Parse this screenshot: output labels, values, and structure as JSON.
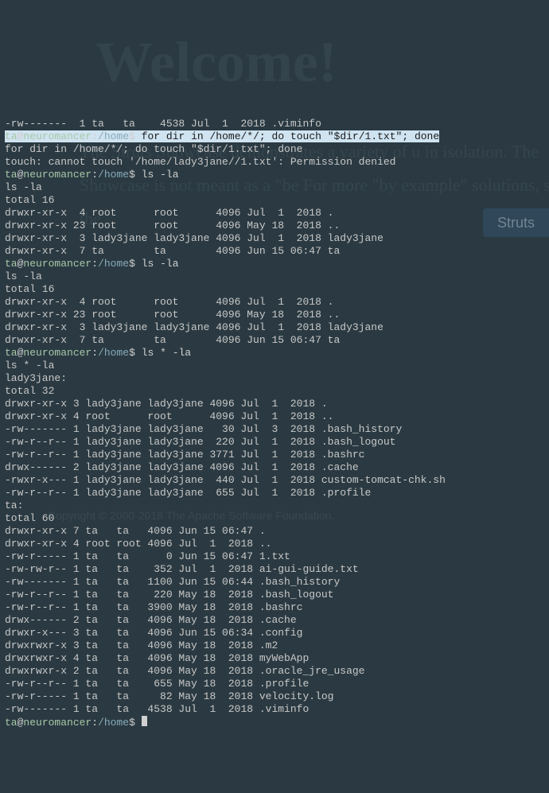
{
  "prompt": {
    "user": "ta",
    "host": "neuromancer",
    "path": "/home",
    "sigil": "$"
  },
  "background": {
    "heading": "Welcome!",
    "paragraph": "The Struts Showcase demonstrates a variety of u       in isolation. The Showcase is not meant as a \"be       For more \"by example\" solutions, see the",
    "button": "Struts",
    "footer": "Copyright © 2000-2018 The Apache Software Foundation."
  },
  "lines": [
    {
      "t": "out",
      "text": "-rw-------  1 ta   ta    4538 Jul  1  2018 .viminfo"
    },
    {
      "t": "prompt_hl",
      "cmd_pre": "for dir in /home/*/; do touch \"$dir/1.txt\"; done"
    },
    {
      "t": "out",
      "text": "for dir in /home/*/; do touch \"$dir/1.txt\"; done"
    },
    {
      "t": "out",
      "text": "touch: cannot touch '/home/lady3jane//1.txt': Permission denied"
    },
    {
      "t": "prompt",
      "cmd": "ls -la"
    },
    {
      "t": "out",
      "text": "ls -la"
    },
    {
      "t": "out",
      "text": "total 16"
    },
    {
      "t": "out",
      "text": "drwxr-xr-x  4 root      root      4096 Jul  1  2018 ."
    },
    {
      "t": "out",
      "text": "drwxr-xr-x 23 root      root      4096 May 18  2018 .."
    },
    {
      "t": "out",
      "text": "drwxr-xr-x  3 lady3jane lady3jane 4096 Jul  1  2018 lady3jane"
    },
    {
      "t": "out",
      "text": "drwxr-xr-x  7 ta        ta        4096 Jun 15 06:47 ta"
    },
    {
      "t": "prompt",
      "cmd": "ls -la"
    },
    {
      "t": "out",
      "text": "ls -la"
    },
    {
      "t": "out",
      "text": "total 16"
    },
    {
      "t": "out",
      "text": "drwxr-xr-x  4 root      root      4096 Jul  1  2018 ."
    },
    {
      "t": "out",
      "text": "drwxr-xr-x 23 root      root      4096 May 18  2018 .."
    },
    {
      "t": "out",
      "text": "drwxr-xr-x  3 lady3jane lady3jane 4096 Jul  1  2018 lady3jane"
    },
    {
      "t": "out",
      "text": "drwxr-xr-x  7 ta        ta        4096 Jun 15 06:47 ta"
    },
    {
      "t": "prompt",
      "cmd": "ls * -la"
    },
    {
      "t": "out",
      "text": "ls * -la"
    },
    {
      "t": "out",
      "text": "lady3jane:"
    },
    {
      "t": "out",
      "text": "total 32"
    },
    {
      "t": "out",
      "text": "drwxr-xr-x 3 lady3jane lady3jane 4096 Jul  1  2018 ."
    },
    {
      "t": "out",
      "text": "drwxr-xr-x 4 root      root      4096 Jul  1  2018 .."
    },
    {
      "t": "out",
      "text": "-rw------- 1 lady3jane lady3jane   30 Jul  3  2018 .bash_history"
    },
    {
      "t": "out",
      "text": "-rw-r--r-- 1 lady3jane lady3jane  220 Jul  1  2018 .bash_logout"
    },
    {
      "t": "out",
      "text": "-rw-r--r-- 1 lady3jane lady3jane 3771 Jul  1  2018 .bashrc"
    },
    {
      "t": "out",
      "text": "drwx------ 2 lady3jane lady3jane 4096 Jul  1  2018 .cache"
    },
    {
      "t": "out",
      "text": "-rwxr-x--- 1 lady3jane lady3jane  440 Jul  1  2018 custom-tomcat-chk.sh"
    },
    {
      "t": "out",
      "text": "-rw-r--r-- 1 lady3jane lady3jane  655 Jul  1  2018 .profile"
    },
    {
      "t": "out",
      "text": ""
    },
    {
      "t": "out",
      "text": "ta:"
    },
    {
      "t": "out",
      "text": "total 60"
    },
    {
      "t": "out",
      "text": "drwxr-xr-x 7 ta   ta   4096 Jun 15 06:47 ."
    },
    {
      "t": "out",
      "text": "drwxr-xr-x 4 root root 4096 Jul  1  2018 .."
    },
    {
      "t": "out",
      "text": "-rw-r----- 1 ta   ta      0 Jun 15 06:47 1.txt"
    },
    {
      "t": "out",
      "text": "-rw-rw-r-- 1 ta   ta    352 Jul  1  2018 ai-gui-guide.txt"
    },
    {
      "t": "out",
      "text": "-rw------- 1 ta   ta   1100 Jun 15 06:44 .bash_history"
    },
    {
      "t": "out",
      "text": "-rw-r--r-- 1 ta   ta    220 May 18  2018 .bash_logout"
    },
    {
      "t": "out",
      "text": "-rw-r--r-- 1 ta   ta   3900 May 18  2018 .bashrc"
    },
    {
      "t": "out",
      "text": "drwx------ 2 ta   ta   4096 May 18  2018 .cache"
    },
    {
      "t": "out",
      "text": "drwxr-x--- 3 ta   ta   4096 Jun 15 06:34 .config"
    },
    {
      "t": "out",
      "text": "drwxrwxr-x 3 ta   ta   4096 May 18  2018 .m2"
    },
    {
      "t": "out",
      "text": "drwxrwxr-x 4 ta   ta   4096 May 18  2018 myWebApp"
    },
    {
      "t": "out",
      "text": "drwxrwxr-x 2 ta   ta   4096 May 18  2018 .oracle_jre_usage"
    },
    {
      "t": "out",
      "text": "-rw-r--r-- 1 ta   ta    655 May 18  2018 .profile"
    },
    {
      "t": "out",
      "text": "-rw-r----- 1 ta   ta     82 May 18  2018 velocity.log"
    },
    {
      "t": "out",
      "text": "-rw------- 1 ta   ta   4538 Jul  1  2018 .viminfo"
    },
    {
      "t": "prompt_cursor",
      "cmd": ""
    }
  ]
}
